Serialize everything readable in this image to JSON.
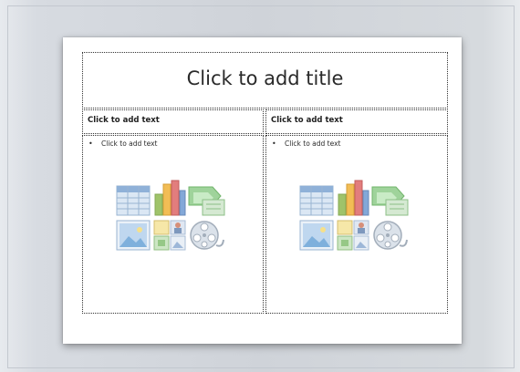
{
  "slide": {
    "title_placeholder": "Click to add title",
    "left_heading_placeholder": "Click to add text",
    "right_heading_placeholder": "Click to add text",
    "left_body_placeholder": "Click to add text",
    "right_body_placeholder": "Click to add text",
    "bullet_char": "•"
  },
  "content_icons": [
    "insert-table-icon",
    "insert-chart-icon",
    "insert-smartart-icon",
    "insert-picture-icon",
    "insert-clip-art-icon",
    "insert-media-icon"
  ],
  "colors": {
    "background": "#d3d7dc",
    "slide": "#ffffff",
    "placeholder_border": "#333333"
  }
}
